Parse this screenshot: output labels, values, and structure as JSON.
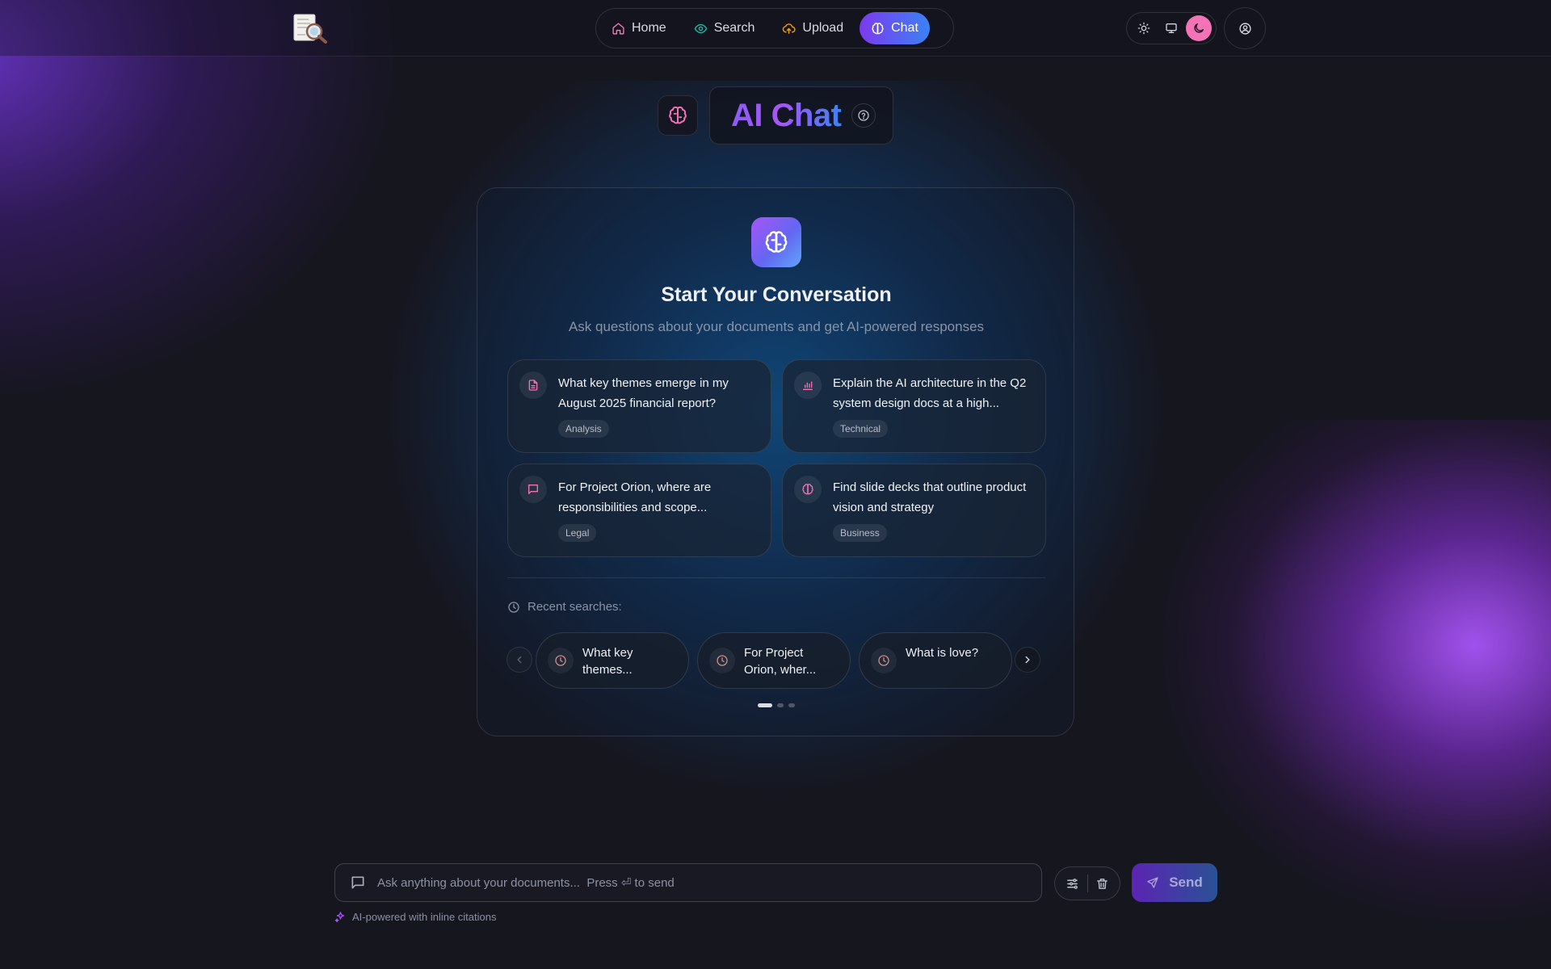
{
  "nav": {
    "items": [
      {
        "label": "Home",
        "icon": "home-icon",
        "color": "#f472b6"
      },
      {
        "label": "Search",
        "icon": "eye-icon",
        "color": "#14b8a6"
      },
      {
        "label": "Upload",
        "icon": "cloud-upload-icon",
        "color": "#f59e0b"
      },
      {
        "label": "Chat",
        "icon": "brain-icon",
        "active": true
      }
    ]
  },
  "theme": {
    "options": [
      "light",
      "system",
      "dark"
    ],
    "selected": "dark"
  },
  "header": {
    "title": "AI Chat"
  },
  "welcome": {
    "title": "Start Your Conversation",
    "subtitle": "Ask questions about your documents and get AI-powered responses"
  },
  "suggestions": [
    {
      "text": "What key themes emerge in my August 2025 financial report?",
      "tag": "Analysis",
      "icon": "document-icon"
    },
    {
      "text": "Explain the AI architecture in the Q2 system design docs at a high...",
      "tag": "Technical",
      "icon": "bar-chart-icon"
    },
    {
      "text": "For Project Orion, where are responsibilities and scope...",
      "tag": "Legal",
      "icon": "message-icon"
    },
    {
      "text": "Find slide decks that outline product vision and strategy",
      "tag": "Business",
      "icon": "brain-icon"
    }
  ],
  "recent": {
    "label": "Recent searches:",
    "items": [
      {
        "text": "What key themes..."
      },
      {
        "text": "For Project Orion, wher..."
      },
      {
        "text": "What is love?"
      }
    ],
    "page": 1,
    "pages": 3
  },
  "composer": {
    "placeholder": "Ask anything about your documents...  Press ⏎ to send",
    "send_label": "Send",
    "footnote": "AI-powered with inline citations"
  },
  "colors": {
    "accent_purple": "#7c3aed",
    "accent_blue": "#3b82f6",
    "accent_pink": "#f472b6"
  }
}
